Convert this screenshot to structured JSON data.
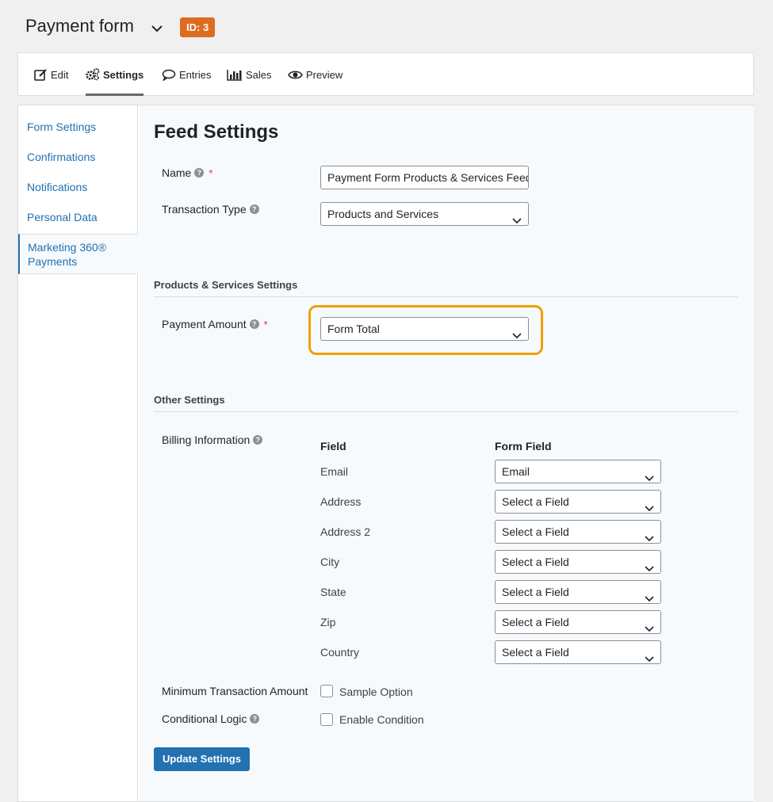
{
  "header": {
    "form_title": "Payment form",
    "id_badge": "ID: 3",
    "badge_color": "#dd6b20"
  },
  "tabs": [
    {
      "label": "Edit",
      "icon": "edit-icon"
    },
    {
      "label": "Settings",
      "icon": "gears-icon",
      "active": true
    },
    {
      "label": "Entries",
      "icon": "speech-bubble-icon"
    },
    {
      "label": "Sales",
      "icon": "bar-chart-icon"
    },
    {
      "label": "Preview",
      "icon": "eye-icon"
    }
  ],
  "sidebar": {
    "items": [
      {
        "label": "Form Settings"
      },
      {
        "label": "Confirmations"
      },
      {
        "label": "Notifications"
      },
      {
        "label": "Personal Data"
      },
      {
        "label": "Marketing 360® Payments",
        "active": true
      }
    ]
  },
  "feed": {
    "title": "Feed Settings",
    "name_label": "Name",
    "name_value": "Payment Form Products & Services Feed",
    "transaction_type_label": "Transaction Type",
    "transaction_type_value": "Products and Services",
    "products_section_title": "Products & Services Settings",
    "payment_amount_label": "Payment Amount",
    "payment_amount_value": "Form Total",
    "highlight_color": "#f0a000",
    "other_section_title": "Other Settings",
    "billing_label": "Billing Information",
    "billing_col_field": "Field",
    "billing_col_form_field": "Form Field",
    "billing_rows": [
      {
        "field": "Email",
        "form_field": "Email"
      },
      {
        "field": "Address",
        "form_field": "Select a Field"
      },
      {
        "field": "Address 2",
        "form_field": "Select a Field"
      },
      {
        "field": "City",
        "form_field": "Select a Field"
      },
      {
        "field": "State",
        "form_field": "Select a Field"
      },
      {
        "field": "Zip",
        "form_field": "Select a Field"
      },
      {
        "field": "Country",
        "form_field": "Select a Field"
      }
    ],
    "min_amount_label": "Minimum Transaction Amount",
    "min_amount_option": "Sample Option",
    "conditional_label": "Conditional Logic",
    "conditional_option": "Enable Condition",
    "update_button": "Update Settings",
    "required_mark": "*",
    "help_glyph": "?"
  }
}
